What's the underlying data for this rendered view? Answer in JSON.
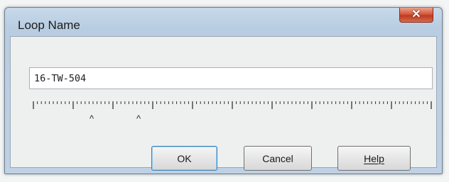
{
  "dialog": {
    "title": "Loop Name",
    "close_glyph": "✕"
  },
  "input": {
    "value": "16-TW-504"
  },
  "ruler": {
    "markers": [
      "^",
      "^"
    ]
  },
  "buttons": {
    "ok_label": "OK",
    "cancel_label": "Cancel",
    "help_label": "Help"
  },
  "colors": {
    "title_bar": "#bfd1e4",
    "close_button": "#c7472b",
    "default_button_border": "#3c7fb1"
  }
}
